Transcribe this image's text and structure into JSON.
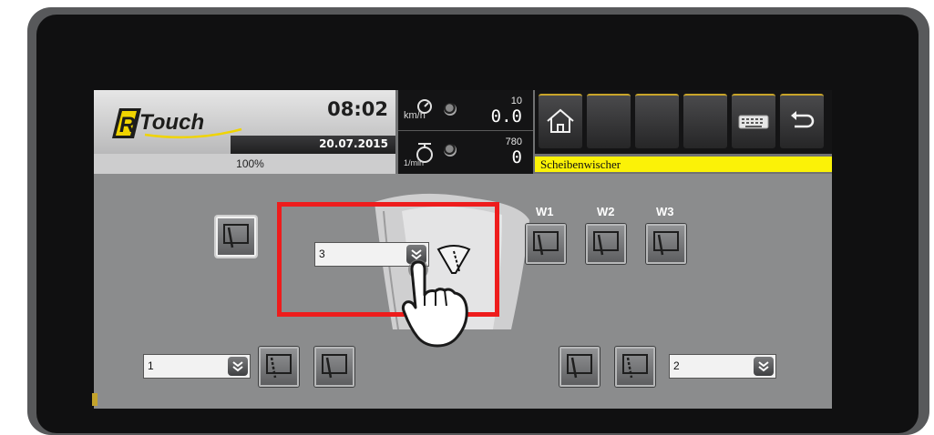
{
  "header": {
    "brand_name": "R Touch",
    "time": "08:02",
    "date": "20.07.2015",
    "percent": "100%"
  },
  "gauges": {
    "speed": {
      "icon": "speedometer-icon",
      "unit": "km/h",
      "small": "10",
      "value": "0.0"
    },
    "rpm": {
      "icon": "engine-rpm-icon",
      "unit": "1/min",
      "small": "780",
      "value": "0"
    }
  },
  "toolbar": {
    "buttons": [
      {
        "icon": "home-icon"
      },
      {
        "icon": ""
      },
      {
        "icon": ""
      },
      {
        "icon": ""
      },
      {
        "icon": "keyboard-icon"
      },
      {
        "icon": "back-icon"
      }
    ],
    "breadcrumb": "Scheibenwischer"
  },
  "wipers": {
    "labels": [
      "W1",
      "W2",
      "W3"
    ],
    "center_select_value": "3",
    "left_select_value": "1",
    "right_select_value": "2"
  },
  "colors": {
    "highlight": "#ee1c1c",
    "breadcrumb_bg": "#fbf207",
    "accent_gold": "#c9a52a"
  }
}
